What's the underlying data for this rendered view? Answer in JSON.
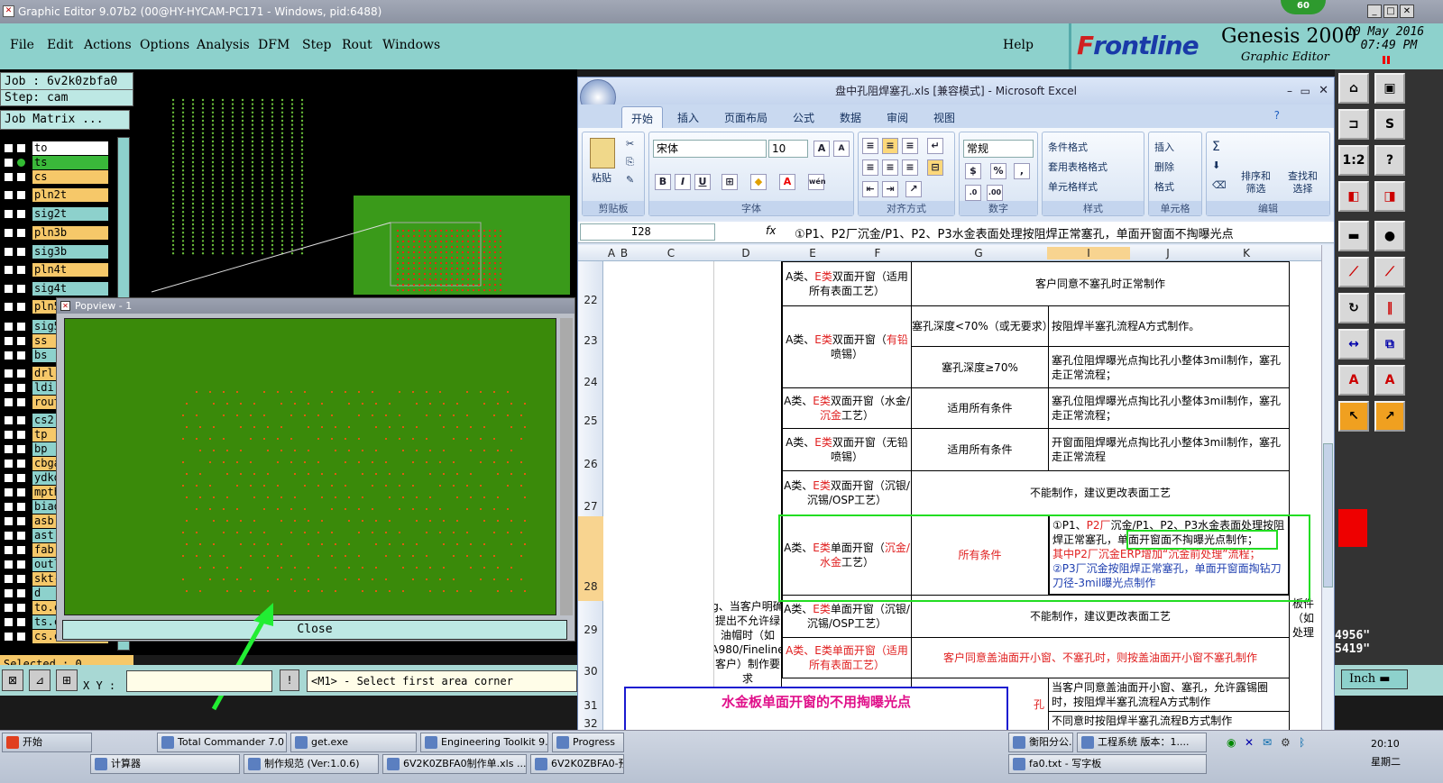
{
  "genesis": {
    "title": "Graphic Editor 9.07b2 (00@HY-HYCAM-PC171 - Windows, pid:6488)",
    "badge": "60",
    "menu": [
      "File",
      "Edit",
      "Actions",
      "Options",
      "Analysis",
      "DFM",
      "Step",
      "Rout",
      "Windows"
    ],
    "help": "Help",
    "brand": "Frontline",
    "brand_f": "F",
    "brand_rest": "rontline",
    "product": "Genesis 2000",
    "product_sub": "Graphic Editor",
    "date": "10 May 2016",
    "time": "07:49 PM",
    "job": "Job : 6v2k0zbfa0",
    "step": "Step: cam",
    "job_matrix": "Job Matrix ...",
    "layers": [
      "to",
      "ts",
      "cs",
      "pln2t",
      "sig2t",
      "pln3b",
      "sig3b",
      "pln4t",
      "sig4t",
      "pln5",
      "sig5",
      "ss",
      "bs",
      "drl",
      "ldi",
      "rout",
      "cs2",
      "tp",
      "bp",
      "cbga",
      "ydko",
      "mpth",
      "biao",
      "asb",
      "ast",
      "fab",
      "outl",
      "skt-",
      "d",
      "to.c",
      "ts.c",
      "cs.c"
    ],
    "selected": "Selected : 0",
    "xy_label": "X Y :",
    "prompt": "<M1> - Select first area corner",
    "popview_title": "Popview - 1",
    "close": "Close",
    "inch": "Inch",
    "coord1": "4956\"",
    "coord2": "5419\""
  },
  "excel": {
    "title": "盘中孔阻焊塞孔.xls [兼容模式] - Microsoft Excel",
    "tabs": [
      "开始",
      "插入",
      "页面布局",
      "公式",
      "数据",
      "审阅",
      "视图"
    ],
    "clipboard": {
      "paste": "粘贴",
      "label": "剪贴板"
    },
    "font": {
      "name": "宋体",
      "size": "10",
      "label": "字体"
    },
    "align_label": "对齐方式",
    "number": {
      "format": "常规",
      "label": "数字"
    },
    "styles": {
      "cond": "条件格式",
      "table": "套用表格格式",
      "cell": "单元格样式",
      "label": "样式"
    },
    "cells": {
      "insert": "插入",
      "delete": "删除",
      "format": "格式",
      "label": "单元格"
    },
    "edit": {
      "sort": "排序和",
      "filter": "筛选",
      "find": "查找和",
      "select": "选择",
      "label": "编辑"
    },
    "namebox": "I28",
    "fx": "fx",
    "formula": "①P1、P2厂沉金/P1、P2、P3水金表面处理按阻焊正常塞孔，单面开窗面不掏曝光点",
    "cols": [
      "A",
      "B",
      "C",
      "D",
      "E",
      "F",
      "G",
      "I",
      "J",
      "K"
    ],
    "rows": [
      "22",
      "23",
      "24",
      "25",
      "26",
      "27",
      "28",
      "29",
      "30",
      "31",
      "32"
    ],
    "r22e_a": "A类、",
    "r22e_b": "E类",
    "r22e_c": "双面开窗（适用所有表面工艺）",
    "r22g": "客户同意不塞孔时正常制作",
    "r23e_a": "A类、",
    "r23e_b": "E类",
    "r23e_c": "双面开窗（",
    "r23e_d": "有铅",
    "r23e_e": "喷锡）",
    "r23g": "塞孔深度<70%（或无要求）",
    "r23i": "按阻焊半塞孔流程A方式制作。",
    "r24g": "塞孔深度≥70%",
    "r24i": "塞孔位阻焊曝光点掏比孔小整体3mil制作，塞孔走正常流程；",
    "r25e_a": "A类、",
    "r25e_b": "E类",
    "r25e_c": "双面开窗（水金/",
    "r25e_d": "沉金",
    "r25e_e": "工艺）",
    "r25g": "适用所有条件",
    "r25i": "塞孔位阻焊曝光点掏比孔小整体3mil制作，塞孔走正常流程；",
    "r26e_a": "A类、",
    "r26e_b": "E类",
    "r26e_c": "双面开窗（无铅喷锡）",
    "r26g": "适用所有条件",
    "r26i": "开窗面阻焊曝光点掏比孔小整体3mil制作，塞孔走正常流程",
    "r27e_a": "A类、",
    "r27e_b": "E类",
    "r27e_c": "双面开窗（沉银/沉锡/OSP工艺）",
    "r27g": "不能制作，建议更改表面工艺",
    "r28e_a": "A类、",
    "r28e_b": "E类",
    "r28e_c": "单面开窗（",
    "r28e_d": "沉金/水金",
    "r28e_e": "工艺）",
    "r28f": "所有条件",
    "r28i_1a": "①P1、",
    "r28i_1b": "P2厂",
    "r28i_1c": "沉金/P1、P2、P3水金表面处理按阻焊正常塞孔，",
    "r28i_1d": "单面开窗面不掏曝光点制作；",
    "r28i_2": "其中P2厂沉金ERP增加“沉金前处理”流程；",
    "r28i_3": "②P3厂沉金按阻焊正常塞孔，单面开窗面掏钻刀刀径-3mil曝光点制作",
    "r29e_a": "A类、",
    "r29e_b": "E类",
    "r29e_c": "单面开窗（沉银/沉锡/OSP工艺）",
    "r29g": "不能制作，建议更改表面工艺",
    "r30e": "A类、E类单面开窗（适用所有表面工艺）",
    "r30g": "客户同意盖油面开小窗、不塞孔时，则按盖油面开小窗不塞孔制作",
    "r31_g": "孔",
    "r31i": "当客户同意盖油面开小窗、塞孔，允许露锡圈时，按阻焊半塞孔流程A方式制作",
    "r32i": "不同意时按阻焊半塞孔流程B方式制作",
    "d_col": "g、当客户明确提出不允许绿油帽时（如A980/Fineline客户）制作要求",
    "k_col_1": "板件",
    "k_col_2": "（如",
    "k_col_3": "处理"
  },
  "textbox": "水金板单面开窗的不用掏曝光点",
  "taskbar": {
    "start": "开始",
    "row1": [
      "Total Commander 7.0 ...",
      "get.exe",
      "Engineering Toolkit 9....",
      "Progress",
      "衡阳分公...",
      "工程系统 版本：1...."
    ],
    "row2": [
      "计算器",
      "制作规范 (Ver:1.0.6)",
      "6V2K0ZBFA0制作单.xls ...",
      "6V2K0ZBFA0-预审",
      "fa0.txt - 写字板"
    ],
    "time": "20:10",
    "day": "星期二"
  }
}
